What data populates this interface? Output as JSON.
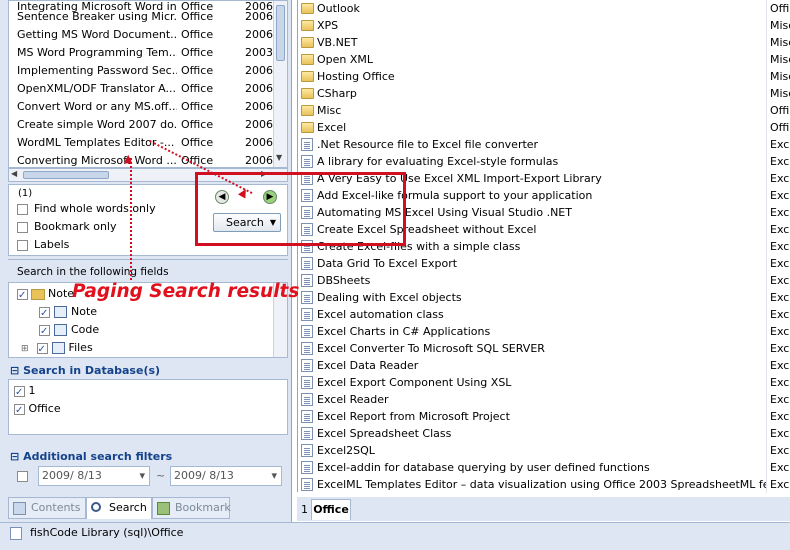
{
  "results": {
    "rows": [
      {
        "title": "Integrating Microsoft Word in ...",
        "category": "Office",
        "year": "2006"
      },
      {
        "title": "Sentence Breaker using Micr...",
        "category": "Office",
        "year": "2006"
      },
      {
        "title": "Getting MS Word Document...",
        "category": "Office",
        "year": "2006"
      },
      {
        "title": "MS Word Programming Tem...",
        "category": "Office",
        "year": "2003"
      },
      {
        "title": "Implementing Password Sec...",
        "category": "Office",
        "year": "2006"
      },
      {
        "title": "OpenXML/ODF Translator A...",
        "category": "Office",
        "year": "2006"
      },
      {
        "title": "Convert Word or any MS.off...",
        "category": "Office",
        "year": "2006"
      },
      {
        "title": "Create simple Word 2007 do...",
        "category": "Office",
        "year": "2006"
      },
      {
        "title": "WordML Templates Editor -...",
        "category": "Office",
        "year": "2006"
      },
      {
        "title": "Converting Microsoft Word ...",
        "category": "Office",
        "year": "2006"
      }
    ]
  },
  "search": {
    "count_label": "(1)",
    "options": [
      {
        "label": "Find whole words only",
        "checked": false
      },
      {
        "label": "Bookmark only",
        "checked": false
      },
      {
        "label": "Labels",
        "checked": false
      }
    ],
    "button_label": "Search",
    "fields_title": "Search in the following fields",
    "fields": [
      {
        "label": "Note",
        "checked": true
      },
      {
        "label": "Note",
        "checked": true
      },
      {
        "label": "Code",
        "checked": true
      },
      {
        "label": "Files",
        "checked": true
      }
    ],
    "database_title": "Search in Database(s)",
    "databases": [
      {
        "label": "1",
        "checked": true
      },
      {
        "label": "Office",
        "checked": true
      }
    ],
    "filters_title": "Additional search filters",
    "date_from": "2009/ 8/13",
    "date_to": "2009/ 8/13"
  },
  "annotation": "Paging Search results",
  "left_tabs": [
    {
      "label": "Contents",
      "icon": "contents-icon"
    },
    {
      "label": "Search",
      "icon": "search-icon"
    },
    {
      "label": "Bookmark",
      "icon": "bookmark-icon"
    }
  ],
  "file_list": [
    {
      "name": "Outlook",
      "cat": "Offi",
      "type": "folder"
    },
    {
      "name": "XPS",
      "cat": "Misc",
      "type": "folder"
    },
    {
      "name": "VB.NET",
      "cat": "Misc",
      "type": "folder"
    },
    {
      "name": "Open XML",
      "cat": "Misc",
      "type": "folder"
    },
    {
      "name": "Hosting Office",
      "cat": "Misc",
      "type": "folder"
    },
    {
      "name": "CSharp",
      "cat": "Misc",
      "type": "folder"
    },
    {
      "name": "Misc",
      "cat": "Offi",
      "type": "folder"
    },
    {
      "name": "Excel",
      "cat": "Offi",
      "type": "folder"
    },
    {
      "name": ".Net Resource file to Excel file converter",
      "cat": "Exce",
      "type": "doc"
    },
    {
      "name": "A library for evaluating Excel-style formulas",
      "cat": "Exce",
      "type": "doc"
    },
    {
      "name": "A Very Easy to Use Excel XML Import-Export Library",
      "cat": "Exce",
      "type": "doc"
    },
    {
      "name": "Add Excel-like formula support to your application",
      "cat": "Exce",
      "type": "doc"
    },
    {
      "name": "Automating MS Excel Using Visual Studio .NET",
      "cat": "Exce",
      "type": "doc"
    },
    {
      "name": "Create Excel Spreadsheet without Excel",
      "cat": "Exce",
      "type": "doc"
    },
    {
      "name": "Create Excel-files with a simple class",
      "cat": "Exce",
      "type": "doc"
    },
    {
      "name": "Data Grid To Excel Export",
      "cat": "Exce",
      "type": "doc"
    },
    {
      "name": "DBSheets",
      "cat": "Exce",
      "type": "doc"
    },
    {
      "name": "Dealing with Excel objects",
      "cat": "Exce",
      "type": "doc"
    },
    {
      "name": "Excel automation class",
      "cat": "Exce",
      "type": "doc"
    },
    {
      "name": "Excel Charts in C# Applications",
      "cat": "Exce",
      "type": "doc"
    },
    {
      "name": "Excel Converter To Microsoft SQL SERVER",
      "cat": "Exce",
      "type": "doc"
    },
    {
      "name": "Excel Data Reader",
      "cat": "Exce",
      "type": "doc"
    },
    {
      "name": "Excel Export Component Using XSL",
      "cat": "Exce",
      "type": "doc"
    },
    {
      "name": "Excel Reader",
      "cat": "Exce",
      "type": "doc"
    },
    {
      "name": "Excel Report from Microsoft Project",
      "cat": "Exce",
      "type": "doc"
    },
    {
      "name": "Excel Spreadsheet Class",
      "cat": "Exce",
      "type": "doc"
    },
    {
      "name": "Excel2SQL",
      "cat": "Exce",
      "type": "doc"
    },
    {
      "name": "Excel-addin for database querying by user defined functions",
      "cat": "Exce",
      "type": "doc"
    },
    {
      "name": "ExcelML Templates Editor – data visualization using Office 2003 SpreadsheetML feat...",
      "cat": "Exce",
      "type": "doc"
    }
  ],
  "right_tabs": [
    {
      "label": "1"
    },
    {
      "label": "Office"
    }
  ],
  "status": {
    "text": "fishCode Library (sql)\\Office"
  }
}
